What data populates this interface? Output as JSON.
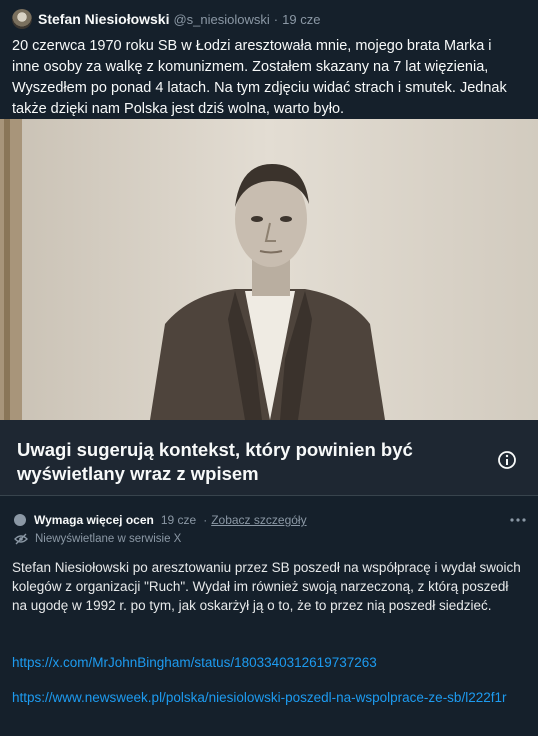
{
  "post": {
    "author_name": "Stefan Niesiołowski",
    "handle": "@s_niesiolowski",
    "separator": "·",
    "time": "19 cze",
    "text": "20 czerwca 1970 roku SB w Łodzi aresztowała mnie, mojego brata Marka i inne osoby za walkę z komunizmem. Zostałem skazany na 7 lat więzienia, Wyszedłem po ponad 4 latach. Na tym zdjęciu widać strach i smutek. Jednak także dzięki nam Polska jest dziś wolna, warto było."
  },
  "community_notes": {
    "notice_title": "Uwagi sugerują kontekst, który powinien być wyświetlany wraz z wpisem",
    "note": {
      "rating_label": "Wymaga więcej ocen",
      "time": "19 cze",
      "separator": "·",
      "details_link": "Zobacz szczegóły",
      "status": "Niewyświetlane w serwisie X",
      "text": "Stefan Niesiołowski po aresztowaniu przez SB poszedł na współpracę i wydał swoich kolegów z organizacji \"Ruch\". Wydał im również swoją narzeczoną, z którą poszedł na ugodę w 1992 r. po tym, jak oskarżył ją o to, że to przez nią poszedł siedzieć.",
      "links": [
        "https://x.com/MrJohnBingham/status/1803340312619737263",
        "https://www.newsweek.pl/polska/niesiolowski-poszedl-na-wspolprace-ze-sb/l222f1r"
      ]
    }
  },
  "icons": {
    "info": "info-circle-icon",
    "more": "more-horizontal-icon",
    "status": "eye-slash-icon"
  },
  "colors": {
    "background": "#15202b",
    "notice_background": "#1e2732",
    "link": "#1d9bf0",
    "muted": "#8b98a5"
  }
}
